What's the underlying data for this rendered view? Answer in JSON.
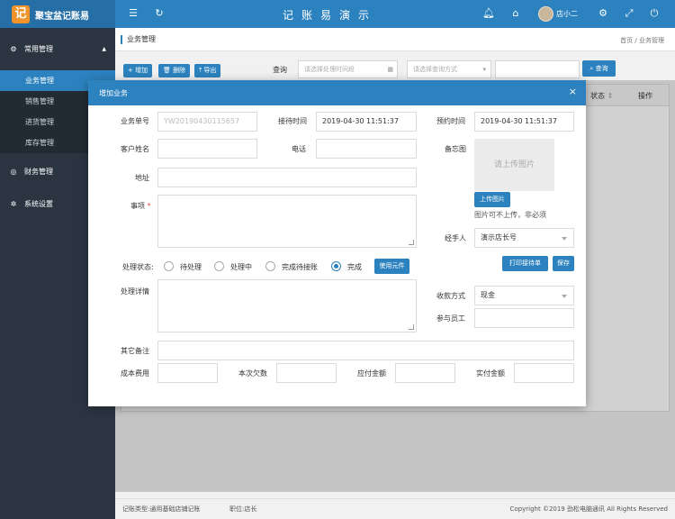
{
  "app": {
    "logo_char": "记",
    "name": "聚宝盆记账易",
    "title": "记账易演示",
    "user": "店小二"
  },
  "sidebar": {
    "groups": [
      {
        "label": "常用管理",
        "icon": "gear-icon"
      },
      {
        "label": "财务管理",
        "icon": "settings-circle-icon"
      },
      {
        "label": "系统设置",
        "icon": "cog-icon"
      }
    ],
    "items": [
      {
        "label": "业务管理"
      },
      {
        "label": "销售管理"
      },
      {
        "label": "进货管理"
      },
      {
        "label": "库存管理"
      }
    ]
  },
  "page": {
    "title": "业务管理",
    "breadcrumb_home": "首页",
    "breadcrumb_sep": "/",
    "breadcrumb_current": "业务管理"
  },
  "toolbar": {
    "add": "增加",
    "delete": "删除",
    "export": "导出",
    "query_label": "查询",
    "time_placeholder": "请选择处理时间段",
    "method_placeholder": "请选择查询方式",
    "search": "查询"
  },
  "grid": {
    "columns": [
      "状态",
      "操作"
    ]
  },
  "modal": {
    "title": "增加业务",
    "order_no_label": "业务单号",
    "order_no_value": "YW20190430115657",
    "receive_time_label": "接待时间",
    "receive_time_value": "2019-04-30 11:51:37",
    "appointment_label": "预约时间",
    "appointment_value": "2019-04-30 11:51:37",
    "customer_label": "客户姓名",
    "phone_label": "电话",
    "memo_image_label": "备忘图",
    "upload_placeholder": "请上传图片",
    "upload_button": "上传图片",
    "upload_hint": "图片可不上传，非必须",
    "address_label": "地址",
    "matter_label": "事项",
    "required_mark": "*",
    "handler_label": "经手人",
    "handler_value": "演示店长号",
    "print_button": "打印接待单",
    "save_button": "保存",
    "status_label": "处理状态:",
    "status_options": [
      "待处理",
      "处理中",
      "完成待接账",
      "完成"
    ],
    "use_parts_button": "使用元件",
    "detail_label": "处理详情",
    "payment_label": "收款方式",
    "payment_value": "现金",
    "staff_label": "参与员工",
    "other_notes_label": "其它备注",
    "cost_label": "成本费用",
    "debt_label": "本次欠数",
    "payable_label": "应付金额",
    "paid_label": "实付金额"
  },
  "footer": {
    "type": "记账类型:通用基础店铺记账",
    "position": "职位:店长",
    "copyright": "Copyright ©2019 劲松电脑通讯 All Rights Reserved"
  },
  "colors": {
    "primary": "#2c82be",
    "sidebar": "#2b3542",
    "logo": "#f0932b"
  }
}
